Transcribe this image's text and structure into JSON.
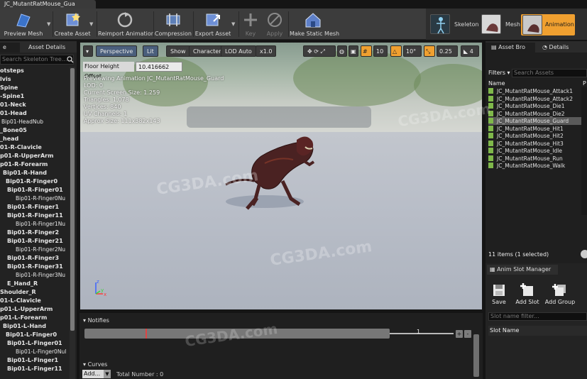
{
  "window": {
    "tab_title": "JC_MutantRatMouse_Gua"
  },
  "toolbar": {
    "buttons": [
      {
        "label": "Preview Mesh",
        "icon": "preview-mesh-icon"
      },
      {
        "label": "Create Asset",
        "icon": "create-asset-icon"
      },
      {
        "label": "Reimport Animation",
        "icon": "reimport-icon"
      },
      {
        "label": "Compression",
        "icon": "compression-icon"
      },
      {
        "label": "Export Asset",
        "icon": "export-asset-icon"
      },
      {
        "label": "Key",
        "icon": "plus-icon"
      },
      {
        "label": "Apply",
        "icon": "apply-icon"
      },
      {
        "label": "Make Static Mesh",
        "icon": "house-icon"
      }
    ],
    "modes": [
      {
        "label": "Skeleton"
      },
      {
        "label": "Mesh"
      },
      {
        "label": "Animation"
      }
    ]
  },
  "left_panel": {
    "tabs": [
      "e",
      "Asset Details"
    ],
    "search_placeholder": "Search Skeleton Tree...",
    "tree": [
      "otsteps",
      "lvis",
      "Spine",
      "-Spine1",
      "01-Neck",
      "01-Head",
      "Bip01-HeadNub",
      "_Bone05",
      "_head",
      "01-R-Clavicle",
      "p01-R-UpperArm",
      "p01-R-Forearm",
      "Bip01-R-Hand",
      "Bip01-R-Finger0",
      "Bip01-R-Finger01",
      "Bip01-R-Finger0Nu",
      "Bip01-R-Finger1",
      "Bip01-R-Finger11",
      "Bip01-R-Finger1Nu",
      "Bip01-R-Finger2",
      "Bip01-R-Finger21",
      "Bip01-R-Finger2Nu",
      "Bip01-R-Finger3",
      "Bip01-R-Finger31",
      "Bip01-R-Finger3Nu",
      "E_Hand_R",
      "Shoulder_R",
      "01-L-Clavicle",
      "p01-L-UpperArm",
      "p01-L-Forearm",
      "Bip01-L-Hand",
      "Bip01-L-Finger0",
      "Bip01-L-Finger01",
      "Bip01-L-Finger0Nul",
      "Bip01-L-Finger1",
      "Bip01-L-Finger11"
    ]
  },
  "viewport": {
    "buttons": [
      "Perspective",
      "Lit",
      "Show",
      "Character",
      "LOD Auto",
      "x1.0"
    ],
    "snap": {
      "grid": "10",
      "angle": "10°",
      "scale": "0.25",
      "camera_speed": "4"
    },
    "floor_height_label": "Floor Height Offset",
    "floor_height_value": "10.416662",
    "info": [
      "Previewing Animation JC_MutantRatMouse_Guard",
      "LOD: 0",
      "Current Screen Size: 1.259",
      "Triangles: 1,078",
      "Vertices: 840",
      "UV Channels: 1",
      "Approx Size: 111x382x143"
    ],
    "axis": {
      "z": "z",
      "x": "x",
      "y": "y"
    }
  },
  "bottom_panel": {
    "notifies_label": "Notifies",
    "frame": "1",
    "plus": "+",
    "minus": "-",
    "curves_label": "Curves",
    "add_label": "Add...",
    "total_number": "Total Number : 0"
  },
  "right_panel": {
    "tabs": [
      "Asset Bro",
      "Details"
    ],
    "filters_label": "Filters",
    "search_placeholder": "Search Assets",
    "col_name": "Name",
    "col_path": "P",
    "assets": [
      "JC_MutantRatMouse_Attack1",
      "JC_MutantRatMouse_Attack2",
      "JC_MutantRatMouse_Die1",
      "JC_MutantRatMouse_Die2",
      "JC_MutantRatMouse_Guard",
      "JC_MutantRatMouse_Hit1",
      "JC_MutantRatMouse_Hit2",
      "JC_MutantRatMouse_Hit3",
      "JC_MutantRatMouse_Idle",
      "JC_MutantRatMouse_Run",
      "JC_MutantRatMouse_Walk"
    ],
    "path_prefix": "/(",
    "selected_index": 4,
    "count_label": "11 items (1 selected)",
    "slot_title": "Anim Slot Manager",
    "slot_buttons": [
      "Save",
      "Add Slot",
      "Add Group"
    ],
    "slot_filter_placeholder": "Slot name filter...",
    "slot_name_header": "Slot Name"
  },
  "watermark": "CG3DA.com",
  "colors": {
    "accent_orange": "#f0a030",
    "asset_green": "#7fb84a",
    "toolbar_bg": "#3c3c3c"
  }
}
